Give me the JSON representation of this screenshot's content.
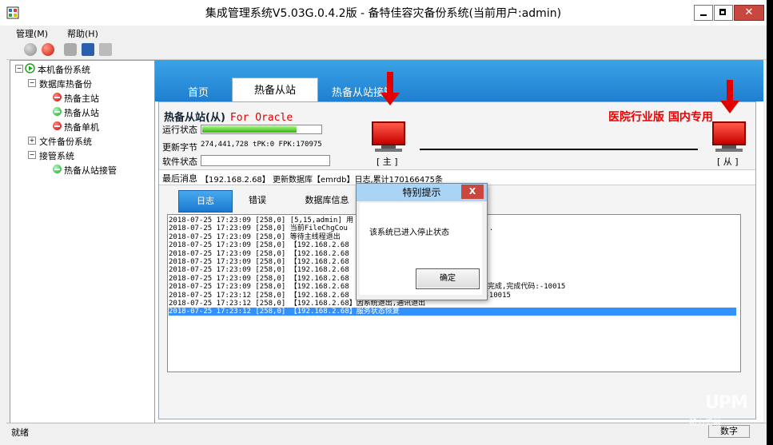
{
  "window": {
    "title": "集成管理系统V5.03G.0.4.2版 - 备特佳容灾备份系统(当前用户:admin)"
  },
  "menu": {
    "manage": "管理(M)",
    "help": "帮助(H)"
  },
  "tree": {
    "root": "本机备份系统",
    "db_hot_backup": "数据库热备份",
    "hot_master": "热备主站",
    "hot_slave": "热备从站",
    "hot_single": "热备单机",
    "file_backup": "文件备份系统",
    "takeover": "接管系统",
    "slave_takeover": "热备从站接管"
  },
  "tabs": {
    "home": "首页",
    "hot_slave": "热备从站",
    "hot_slave_takeover": "热备从站接管"
  },
  "panel": {
    "title": "热备从站(从)",
    "db_type": "For Oracle",
    "banner": "医院行业版 国内专用",
    "run_status_label": "运行状态",
    "run_progress": 0.8,
    "update_bytes_label": "更新字节",
    "update_bytes_value": "274,441,728 tPK:0 FPK:170975",
    "software_status_label": "软件状态",
    "master_label": "[ 主 ]",
    "slave_label": "[ 从 ]",
    "last_msg_label": "最后消息",
    "last_msg_value": "【192.168.2.68】 更新数据库【emrdb】日志,累计170166475条"
  },
  "subtabs": {
    "log": "日志",
    "error": "错误",
    "db_info": "数据库信息"
  },
  "log": {
    "lines": [
      {
        "time": "2018-07-25 17:23:09",
        "code": "[258,0]",
        "text": "[5,15,admin] 用",
        "tail": "止"
      },
      {
        "time": "2018-07-25 17:23:09",
        "code": "[258,0]",
        "text": "当前FileChgCou",
        "tail": "..."
      },
      {
        "time": "2018-07-25 17:23:09",
        "code": "[258,0]",
        "text": "等待主线程退出",
        "tail": ""
      },
      {
        "time": "2018-07-25 17:23:09",
        "code": "[258,0]",
        "text": "【192.168.2.68",
        "tail": ""
      },
      {
        "time": "2018-07-25 17:23:09",
        "code": "[258,0]",
        "text": "【192.168.2.68",
        "tail": ""
      },
      {
        "time": "2018-07-25 17:23:09",
        "code": "[258,0]",
        "text": "【192.168.2.68",
        "tail": ""
      },
      {
        "time": "2018-07-25 17:23:09",
        "code": "[258,0]",
        "text": "【192.168.2.68",
        "tail": ""
      },
      {
        "time": "2018-07-25 17:23:09",
        "code": "[258,0]",
        "text": "【192.168.2.68",
        "tail": "息"
      },
      {
        "time": "2018-07-25 17:23:09",
        "code": "[258,0]",
        "text": "【192.168.2.68",
        "tail": "息完成,完成代码:-10015"
      },
      {
        "time": "2018-07-25 17:23:12",
        "code": "[258,0]",
        "text": "【192.168.2.68",
        "tail": ":-10015"
      },
      {
        "time": "2018-07-25 17:23:12",
        "code": "[258,0]",
        "text": "【192.168.2.68】因系统退出,通讯退出",
        "tail": ""
      },
      {
        "time": "2018-07-25 17:23:12",
        "code": "[258,0]",
        "text": "【192.168.2.68】服务状态恢复",
        "tail": ""
      }
    ],
    "selected_index": 11
  },
  "dialog": {
    "title": "特别提示",
    "close": "X",
    "message": "该系统已进入停止状态",
    "ok": "确定"
  },
  "status": {
    "left": "就绪",
    "right": "数字"
  },
  "watermark": {
    "logo": "UPM",
    "caption": "和力记易"
  },
  "colors": {
    "tab_band": "#1f7fd0",
    "banner": "#e00000",
    "selection": "#3390ff"
  }
}
